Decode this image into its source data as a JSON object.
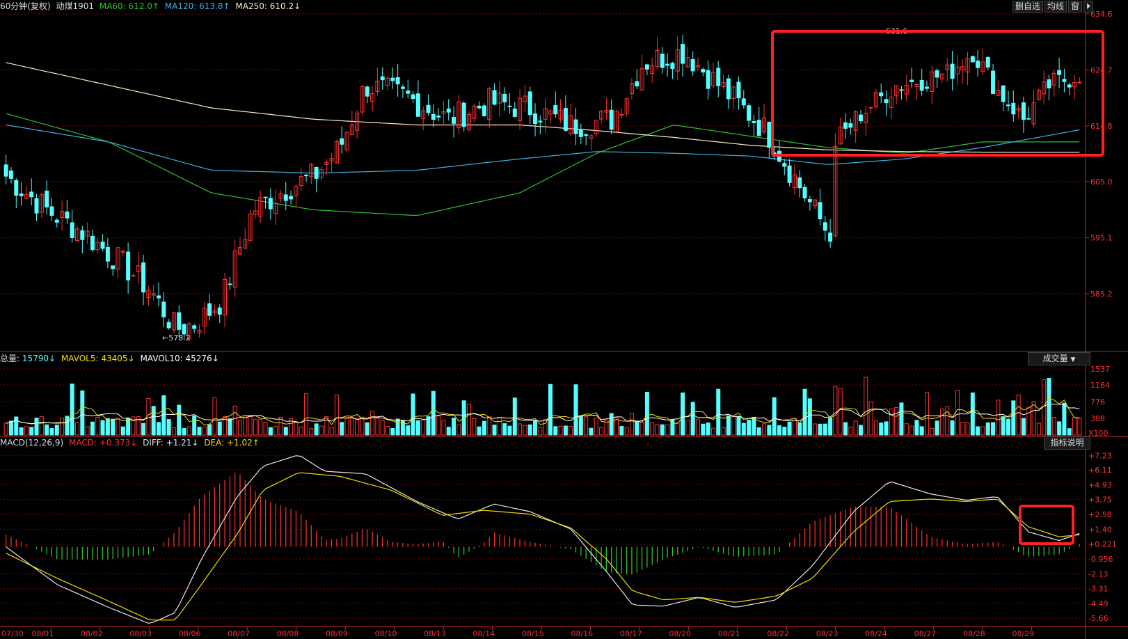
{
  "header": {
    "period_label": "60分钟(复权)",
    "symbol": "动煤1901",
    "ma60_label": "MA60:",
    "ma60_value": "612.0↑",
    "ma120_label": "MA120:",
    "ma120_value": "613.8↑",
    "ma250_label": "MA250:",
    "ma250_value": "610.2↓",
    "buttons": [
      "删自选",
      "均线",
      "窗"
    ],
    "exit_glyph": "⏵"
  },
  "volume_header": {
    "total_label": "总量:",
    "total_value": "15790↓",
    "mavol5_label": "MAVOL5:",
    "mavol5_value": "43405↓",
    "mavol10_label": "MAVOL10:",
    "mavol10_value": "45276↓",
    "dropdown_label": "成交量"
  },
  "macd_header": {
    "title": "MACD(12,26,9)",
    "macd_label": "MACD:",
    "macd_value": "+0.373↓",
    "diff_label": "DIFF:",
    "diff_value": "+1.21↓",
    "dea_label": "DEA:",
    "dea_value": "+1.02↑",
    "help_button": "指标说明"
  },
  "colors": {
    "background": "#000000",
    "up": "#ff3232",
    "down": "#54ffff",
    "ma60": "#2fc02f",
    "ma120": "#3fb0e0",
    "ma250": "#f5f0c8",
    "grid": "#7a0000",
    "axis": "#cc2222",
    "diff": "#e8e8e8",
    "dea": "#f0e000",
    "macd_up": "#ff3232",
    "macd_down": "#2fd02f",
    "highlight": "#ff2020"
  },
  "chart_data": [
    {
      "type": "candlestick",
      "title": "60分钟(复权) 动煤1901",
      "y_ticks": [
        "634.6",
        "624.7",
        "614.8",
        "605.0",
        "595.1",
        "585.2"
      ],
      "y_tick_values": [
        634.6,
        624.7,
        614.8,
        605.0,
        595.1,
        585.2
      ],
      "ylim": [
        575,
        634.6
      ],
      "x_ticks": [
        "07/30",
        "08/01",
        "08/02",
        "08/03",
        "08/06",
        "08/07",
        "08/08",
        "08/09",
        "08/10",
        "08/13",
        "08/14",
        "08/15",
        "08/16",
        "08/17",
        "08/20",
        "08/21",
        "08/22",
        "08/23",
        "08/24",
        "08/27",
        "08/28",
        "08/29"
      ],
      "annotations": [
        {
          "text": "←631.6",
          "value": 631.6
        },
        {
          "text": "←578.2",
          "value": 578.2
        }
      ],
      "highlight_box": "top-right",
      "series": [
        {
          "name": "MA60",
          "color": "#2fc02f",
          "anchors": [
            [
              0,
              617
            ],
            [
              20,
              612
            ],
            [
              40,
              603
            ],
            [
              60,
              600
            ],
            [
              80,
              599
            ],
            [
              100,
              603
            ],
            [
              115,
              610
            ],
            [
              130,
              615
            ],
            [
              145,
              613
            ],
            [
              160,
              611
            ],
            [
              175,
              610
            ],
            [
              190,
              612
            ],
            [
              210,
              612
            ]
          ]
        },
        {
          "name": "MA120",
          "color": "#3fb0e0",
          "anchors": [
            [
              0,
              615
            ],
            [
              20,
              612
            ],
            [
              40,
              607
            ],
            [
              60,
              606.5
            ],
            [
              80,
              607
            ],
            [
              100,
              609
            ],
            [
              115,
              610.3
            ],
            [
              130,
              610
            ],
            [
              145,
              609.5
            ],
            [
              160,
              608
            ],
            [
              175,
              609
            ],
            [
              190,
              611
            ],
            [
              210,
              614.3
            ]
          ]
        },
        {
          "name": "MA250",
          "color": "#f5f0c8",
          "anchors": [
            [
              0,
              626
            ],
            [
              20,
              622
            ],
            [
              40,
              618
            ],
            [
              60,
              616
            ],
            [
              80,
              615
            ],
            [
              100,
              615
            ],
            [
              115,
              614
            ],
            [
              130,
              612.8
            ],
            [
              145,
              611.4
            ],
            [
              160,
              610.6
            ],
            [
              175,
              610.3
            ],
            [
              190,
              610.2
            ],
            [
              210,
              610.2
            ]
          ]
        }
      ]
    },
    {
      "type": "bar",
      "title": "成交量",
      "y_ticks": [
        "1537",
        "1164",
        "776",
        "388",
        "X100"
      ],
      "y_tick_values": [
        1537,
        1164,
        776,
        388
      ],
      "ylim": [
        0,
        1537
      ],
      "series": [
        {
          "name": "MAVOL5",
          "color": "#f0e000"
        },
        {
          "name": "MAVOL10",
          "color": "#ffffff"
        }
      ]
    },
    {
      "type": "bar",
      "title": "MACD(12,26,9)",
      "y_ticks": [
        "+7.23",
        "+6.11",
        "+4.93",
        "+3.75",
        "+2.58",
        "+1.40",
        "+0.221",
        "-0.956",
        "-2.13",
        "-3.31",
        "-4.49",
        "-5.66"
      ],
      "y_tick_values": [
        7.23,
        6.11,
        4.93,
        3.75,
        2.58,
        1.4,
        0.221,
        -0.956,
        -2.13,
        -3.31,
        -4.49,
        -5.66
      ],
      "ylim": [
        -6.2,
        7.6
      ],
      "highlight_box": "right",
      "series": [
        {
          "name": "DIFF",
          "color": "#e8e8e8",
          "anchors": [
            [
              0,
              0.0
            ],
            [
              10,
              -3.0
            ],
            [
              20,
              -4.8
            ],
            [
              28,
              -6.1
            ],
            [
              33,
              -5.2
            ],
            [
              38,
              -1.0
            ],
            [
              45,
              4.0
            ],
            [
              50,
              6.4
            ],
            [
              57,
              7.3
            ],
            [
              62,
              6.0
            ],
            [
              70,
              5.8
            ],
            [
              80,
              3.6
            ],
            [
              88,
              2.2
            ],
            [
              95,
              3.4
            ],
            [
              102,
              2.8
            ],
            [
              110,
              1.4
            ],
            [
              117,
              -2.0
            ],
            [
              122,
              -4.6
            ],
            [
              128,
              -4.7
            ],
            [
              135,
              -4.0
            ],
            [
              142,
              -4.8
            ],
            [
              150,
              -4.2
            ],
            [
              157,
              -1.5
            ],
            [
              165,
              2.8
            ],
            [
              172,
              5.2
            ],
            [
              180,
              4.2
            ],
            [
              187,
              3.7
            ],
            [
              193,
              4.0
            ],
            [
              199,
              1.2
            ],
            [
              205,
              0.5
            ],
            [
              210,
              1.2
            ]
          ]
        },
        {
          "name": "DEA",
          "color": "#f0e000",
          "anchors": [
            [
              0,
              -0.5
            ],
            [
              10,
              -2.5
            ],
            [
              20,
              -4.3
            ],
            [
              28,
              -5.8
            ],
            [
              33,
              -5.8
            ],
            [
              38,
              -3.0
            ],
            [
              45,
              1.0
            ],
            [
              50,
              4.5
            ],
            [
              57,
              5.9
            ],
            [
              65,
              5.6
            ],
            [
              75,
              4.5
            ],
            [
              85,
              2.5
            ],
            [
              93,
              2.9
            ],
            [
              102,
              2.6
            ],
            [
              110,
              1.5
            ],
            [
              117,
              -1.0
            ],
            [
              122,
              -3.5
            ],
            [
              128,
              -4.2
            ],
            [
              135,
              -4.0
            ],
            [
              142,
              -4.4
            ],
            [
              150,
              -3.9
            ],
            [
              157,
              -2.5
            ],
            [
              165,
              1.2
            ],
            [
              172,
              3.6
            ],
            [
              180,
              3.8
            ],
            [
              187,
              3.6
            ],
            [
              193,
              3.8
            ],
            [
              199,
              1.6
            ],
            [
              205,
              0.8
            ],
            [
              210,
              1.0
            ]
          ]
        }
      ]
    }
  ]
}
